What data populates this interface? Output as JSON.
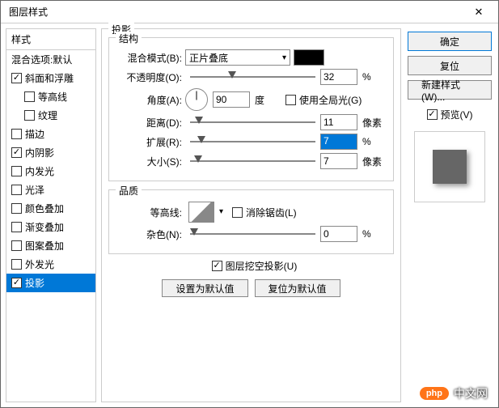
{
  "window": {
    "title": "图层样式"
  },
  "sidebar": {
    "header": "样式",
    "blending": "混合选项:默认",
    "items": [
      {
        "label": "斜面和浮雕",
        "checked": true,
        "indent": false
      },
      {
        "label": "等高线",
        "checked": false,
        "indent": true
      },
      {
        "label": "纹理",
        "checked": false,
        "indent": true
      },
      {
        "label": "描边",
        "checked": false,
        "indent": false
      },
      {
        "label": "内阴影",
        "checked": true,
        "indent": false
      },
      {
        "label": "内发光",
        "checked": false,
        "indent": false
      },
      {
        "label": "光泽",
        "checked": false,
        "indent": false
      },
      {
        "label": "颜色叠加",
        "checked": false,
        "indent": false
      },
      {
        "label": "渐变叠加",
        "checked": false,
        "indent": false
      },
      {
        "label": "图案叠加",
        "checked": false,
        "indent": false
      },
      {
        "label": "外发光",
        "checked": false,
        "indent": false
      },
      {
        "label": "投影",
        "checked": true,
        "indent": false,
        "selected": true
      }
    ]
  },
  "main": {
    "title": "投影",
    "structure": {
      "legend": "结构",
      "blend_mode_label": "混合模式(B):",
      "blend_mode_value": "正片叠底",
      "opacity_label": "不透明度(O):",
      "opacity_value": "32",
      "opacity_unit": "%",
      "angle_label": "角度(A):",
      "angle_value": "90",
      "angle_unit": "度",
      "global_light_label": "使用全局光(G)",
      "global_light_checked": false,
      "distance_label": "距离(D):",
      "distance_value": "11",
      "distance_unit": "像素",
      "spread_label": "扩展(R):",
      "spread_value": "7",
      "spread_unit": "%",
      "size_label": "大小(S):",
      "size_value": "7",
      "size_unit": "像素"
    },
    "quality": {
      "legend": "品质",
      "contour_label": "等高线:",
      "antialias_label": "消除锯齿(L)",
      "antialias_checked": false,
      "noise_label": "杂色(N):",
      "noise_value": "0",
      "noise_unit": "%"
    },
    "knockout_label": "图层挖空投影(U)",
    "knockout_checked": true,
    "defaults_set": "设置为默认值",
    "defaults_reset": "复位为默认值"
  },
  "right": {
    "ok": "确定",
    "cancel": "复位",
    "new_style": "新建样式(W)...",
    "preview_label": "预览(V)",
    "preview_checked": true
  },
  "watermark": {
    "logo": "php",
    "text": "中文网"
  }
}
